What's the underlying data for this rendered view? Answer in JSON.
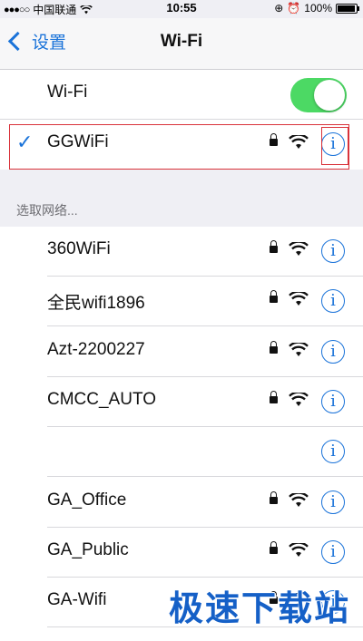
{
  "status": {
    "carrier": "中国联通",
    "time": "10:55",
    "battery": "100%",
    "battery_level": 1.0
  },
  "nav": {
    "back_label": "设置",
    "title": "Wi-Fi"
  },
  "wifi_toggle": {
    "label": "Wi-Fi",
    "on": true
  },
  "connected": {
    "name": "GGWiFi"
  },
  "section_label": "选取网络...",
  "networks": [
    {
      "name": "360WiFi",
      "locked": true,
      "wifi": true
    },
    {
      "name": "全民wifi1896",
      "locked": true,
      "wifi": true
    },
    {
      "name": "Azt-2200227",
      "locked": true,
      "wifi": true
    },
    {
      "name": "CMCC_AUTO",
      "locked": true,
      "wifi": true
    },
    {
      "name": "",
      "locked": false,
      "wifi": false
    },
    {
      "name": "GA_Office",
      "locked": true,
      "wifi": true
    },
    {
      "name": "GA_Public",
      "locked": true,
      "wifi": true
    },
    {
      "name": "GA-Wifi",
      "locked": true,
      "wifi": true
    }
  ],
  "info_glyph": "i",
  "watermark": "极速下载站",
  "colors": {
    "accent": "#1a73d9",
    "toggle_on": "#4cd964",
    "highlight": "#d9323a"
  }
}
